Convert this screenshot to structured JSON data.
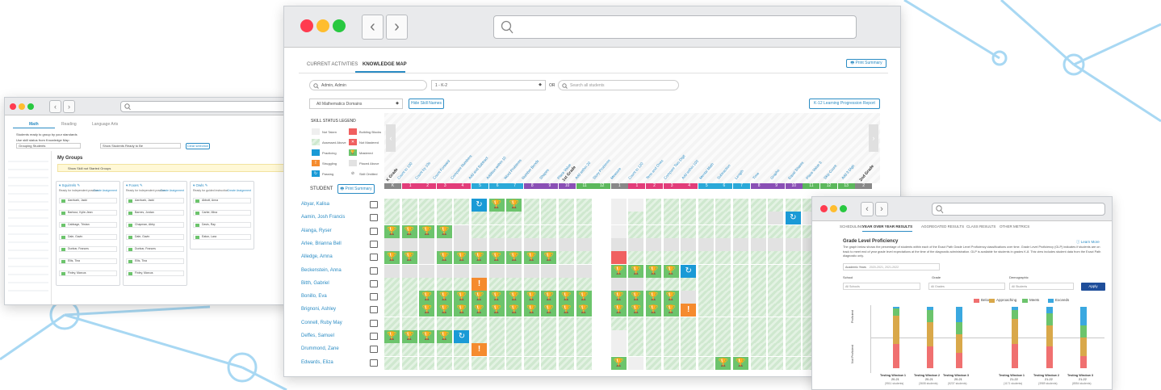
{
  "win_left": {
    "tabs": [
      "Math",
      "Reading",
      "Language Arts"
    ],
    "intro": "Students ready to group by your standards",
    "filter_label": "Use skill status from Knowledge Map",
    "select1": "Grouping Students",
    "select2": "Show Students Ready to Be",
    "clear_btn": "Clear selection",
    "my_groups": "My Groups",
    "banner": "Show Skill not Started Groups",
    "cards": [
      {
        "title": "Squirrels",
        "sub": "Ready for independent practice",
        "link": "Create Assignment",
        "students": [
          "Aardvark, Jacki",
          "Barbour, Kylie-Jean",
          "Cabbage, Tristan",
          "Dale, Gavin",
          "Dunbar, Frances",
          "Ellis, Tina",
          "Finley, Marcus"
        ]
      },
      {
        "title": "Foxes",
        "sub": "Ready for independent practice",
        "link": "Create Assignment",
        "students": [
          "Aardvark, Jacki",
          "Barnes, Jordan",
          "Chapman, Abby",
          "Dale, Gavin",
          "Dunbar, Frances",
          "Ellis, Tina",
          "Finley, Marcus"
        ]
      },
      {
        "title": "Owls",
        "sub": "Ready for guided instruction",
        "link": "Create Assignment",
        "students": [
          "Abbott, Anna",
          "Carter, Mina",
          "Davis, Ray",
          "Eaton, Lara"
        ]
      }
    ]
  },
  "win_main": {
    "tab_activities": "CURRENT ACTIVITIES",
    "tab_map": "KNOWLEDGE MAP",
    "print_btn": "Print Summary",
    "search_val": "Admin, Admin",
    "grade_select": "1 - K-2",
    "or": "OR",
    "search_students": "Search all students",
    "domain_select": "All Mathematics Domains",
    "hide_btn": "Hide Skill Names",
    "progress_btn": "K-12 Learning Progression Report",
    "legend_title": "SKILL STATUS LEGEND",
    "legend": [
      "Not Taken",
      "Building Blocks",
      "Assessed Above",
      "Not Mastered",
      "Practicing",
      "Mastered",
      "Struggling",
      "Placed Above",
      "Passing",
      "Skill Omitted"
    ],
    "student_label": "STUDENT",
    "print_summary": "Print Summary",
    "grade_k": "K Grade",
    "grade_1": "1st Grade",
    "grade_2": "2nd Grade",
    "students": [
      "Abyar, Kalisa",
      "Aamin, Josh Francis",
      "Alanga, Ryser",
      "Arlee, Brianna Bell",
      "Alledge, Amna",
      "Beckenstein, Anna",
      "Bitth, Gabriel",
      "Bonillo, Eva",
      "Brignoni, Ashley",
      "Connell, Ruby May",
      "Deffes, Samuel",
      "Drummond, Zane",
      "Edwards, Eliza"
    ],
    "skills": [
      "Count to 100",
      "Count by 10s",
      "Count Forward",
      "Compare Numbers",
      "Add and Subtract",
      "Addition within 10",
      "Word Problems",
      "Number Bonds",
      "Shapes",
      "Place Value",
      "Add within 20",
      "Story Problems",
      "Measure",
      "Count to 120",
      "Tens and Ones",
      "Compare Two Digit",
      "Add within 100",
      "Mental Math",
      "Subtraction",
      "Length",
      "Time",
      "Graphs",
      "Equal Shares",
      "Place Value 3",
      "Skip Count",
      "Add 3 Digit"
    ]
  },
  "win_right": {
    "tabs": [
      "SCHEDULING",
      "YEAR OVER YEAR RESULTS",
      "AGGREGATED RESULTS",
      "CLASS RESULTS",
      "OTHER METRICS"
    ],
    "title": "Grade Level Proficiency",
    "learn_more": "Learn More",
    "desc": "The graph below shows the percentage of students within each of the Exact Path Grade Level Proficiency classifications over time. Grade Level Proficiency (GLP) indicates if students are on track to meet end of year grade level expectations at the time of the diagnostic administration. GLP is available for students in grades K-8. This view includes student data from the Exact Path diagnostic only.",
    "years_label": "Academic Years",
    "years_val": "2020-2021, 2021-2022",
    "school_label": "School",
    "school_val": "All Schools",
    "grade_label": "Grade",
    "grade_val": "All Grades",
    "demo_label": "Demographic",
    "demo_val": "All Students",
    "apply": "Apply",
    "legend": [
      "Below",
      "Approaching",
      "Meets",
      "Exceeds"
    ],
    "axis_proficient": "Proficient",
    "axis_not": "Not Proficient",
    "windows": [
      {
        "name": "Testing Window 1",
        "year": "20-21",
        "n": "(9511 students)"
      },
      {
        "name": "Testing Window 2",
        "year": "20-21",
        "n": "(3608 students)"
      },
      {
        "name": "Testing Window 3",
        "year": "20-21",
        "n": "(5237 students)"
      },
      {
        "name": "Testing Window 1",
        "year": "21-22",
        "n": "(1171 students)"
      },
      {
        "name": "Testing Window 2",
        "year": "21-22",
        "n": "(3989 students)"
      },
      {
        "name": "Testing Window 3",
        "year": "21-22",
        "n": "(8554 students)"
      }
    ],
    "colors": {
      "below": "#f07070",
      "approaching": "#d9a84a",
      "meets": "#6cc46c",
      "exceeds": "#3aa8e0"
    }
  }
}
